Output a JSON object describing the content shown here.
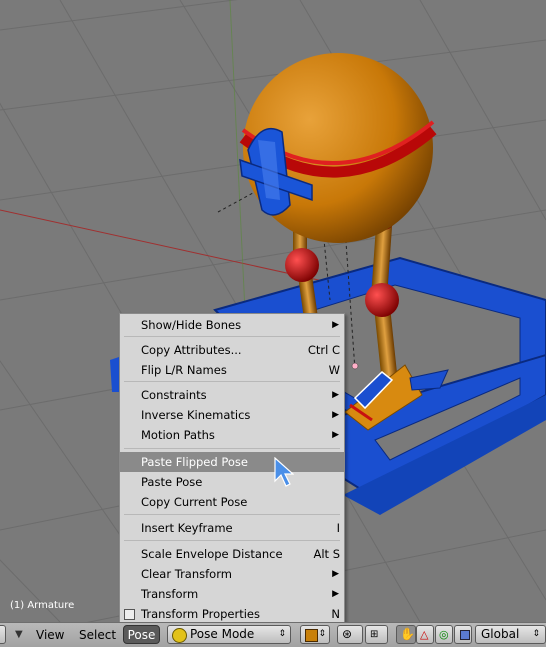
{
  "viewport": {
    "status_text": "(1) Armature"
  },
  "pose_menu": {
    "items": [
      {
        "label": "Show/Hide Bones",
        "shortcut": "",
        "submenu": true
      },
      {
        "label": "Copy Attributes...",
        "shortcut": "Ctrl C",
        "submenu": false
      },
      {
        "label": "Flip L/R Names",
        "shortcut": "W",
        "submenu": false
      },
      {
        "label": "Constraints",
        "shortcut": "",
        "submenu": true
      },
      {
        "label": "Inverse Kinematics",
        "shortcut": "",
        "submenu": true
      },
      {
        "label": "Motion Paths",
        "shortcut": "",
        "submenu": true
      },
      {
        "label": "Paste Flipped Pose",
        "shortcut": "",
        "submenu": false,
        "highlighted": true
      },
      {
        "label": "Paste Pose",
        "shortcut": "",
        "submenu": false
      },
      {
        "label": "Copy Current Pose",
        "shortcut": "",
        "submenu": false
      },
      {
        "label": "Insert Keyframe",
        "shortcut": "I",
        "submenu": false
      },
      {
        "label": "Scale Envelope Distance",
        "shortcut": "Alt S",
        "submenu": false
      },
      {
        "label": "Clear Transform",
        "shortcut": "",
        "submenu": true
      },
      {
        "label": "Transform",
        "shortcut": "",
        "submenu": true
      },
      {
        "label": "Transform Properties",
        "shortcut": "N",
        "submenu": false,
        "checkbox": true
      }
    ]
  },
  "header": {
    "view_label": "View",
    "select_label": "Select",
    "pose_label": "Pose",
    "mode_value": "Pose Mode",
    "orientation_value": "Global"
  },
  "colors": {
    "viewport_bg": "#7a7a7a",
    "menu_bg": "#d6d6d6",
    "menu_highlight": "#8a8a8a",
    "mesh_orange": "#d88a10",
    "mesh_red": "#c81010",
    "mesh_blue": "#1450d0"
  }
}
